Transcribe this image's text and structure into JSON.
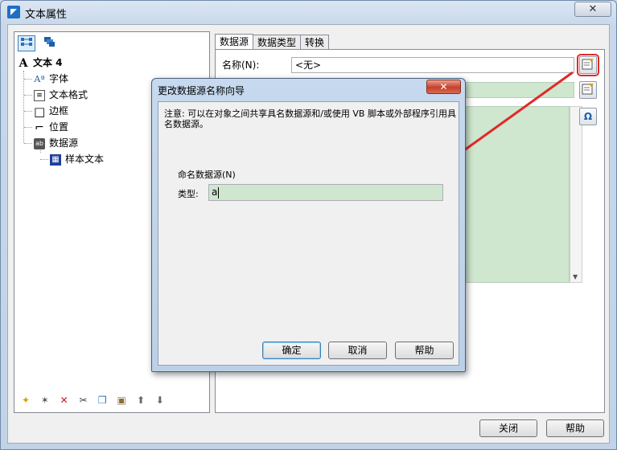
{
  "window": {
    "title": "文本属性",
    "close_glyph": "✕"
  },
  "tree": {
    "items": [
      {
        "label": "文本 4",
        "icon": "text-object-icon",
        "glyph": "A"
      },
      {
        "label": "字体",
        "icon": "font-icon",
        "glyph": "Aª"
      },
      {
        "label": "文本格式",
        "icon": "text-format-icon",
        "glyph": "≡"
      },
      {
        "label": "边框",
        "icon": "border-icon",
        "glyph": "□"
      },
      {
        "label": "位置",
        "icon": "position-icon",
        "glyph": "⌐"
      },
      {
        "label": "数据源",
        "icon": "datasource-icon",
        "glyph": "ab"
      },
      {
        "label": "样本文本",
        "icon": "sample-text-icon",
        "glyph": "▦"
      }
    ]
  },
  "tabs": [
    {
      "label": "数据源",
      "active": true
    },
    {
      "label": "数据类型",
      "active": false
    },
    {
      "label": "转换",
      "active": false
    }
  ],
  "datasource": {
    "name_label": "名称(N):",
    "name_value": "<无>"
  },
  "buttons": {
    "close": "关闭",
    "help": "帮助"
  },
  "dialog": {
    "title": "更改数据源名称向导",
    "note": "注意: 可以在对象之间共享具名数据源和/或使用 VB 脚本或外部程序引用具名数据源。",
    "group_label": "命名数据源(N)",
    "type_label": "类型:",
    "type_value": "a",
    "ok": "确定",
    "cancel": "取消",
    "help": "帮助",
    "close_glyph": "✕"
  },
  "colors": {
    "accent_red": "#e02a2a",
    "green_field": "#cfe7cf"
  }
}
